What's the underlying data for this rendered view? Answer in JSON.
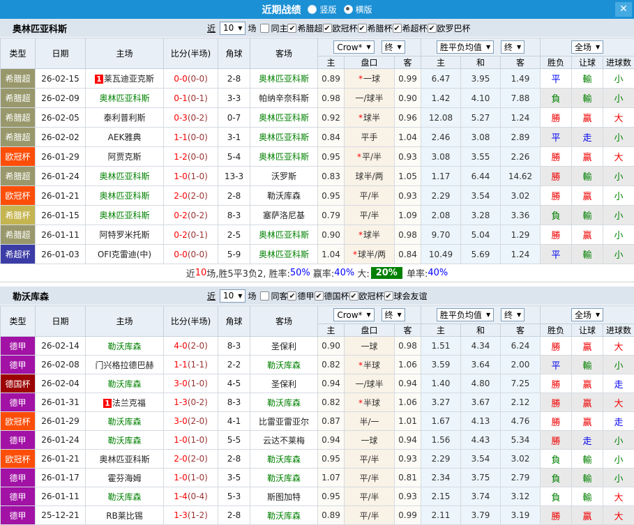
{
  "titlebar": {
    "title": "近期战绩",
    "vertical": "竖版",
    "horizontal": "横版",
    "close": "✕"
  },
  "colors": {
    "titlebar_bg": "#1b90d5",
    "league": {
      "希腊超": "#98986c",
      "欧冠杯": "#fc4e09",
      "希腊杯": "#c5b550",
      "希超杯": "#3c3ca6",
      "德甲": "#a112a5",
      "德国杯": "#9c0303"
    },
    "verdict": {
      "勝": "#f00000",
      "贏": "#f00000",
      "大": "#f00000",
      "平": "#0000f0",
      "走": "#0000f0",
      "負": "#008000",
      "輸": "#008000",
      "小": "#008000"
    }
  },
  "header": {
    "near": "近",
    "games_unit": "场",
    "cols": {
      "type": "类型",
      "date": "日期",
      "home": "主场",
      "score": "比分(半场)",
      "corner": "角球",
      "away": "客场",
      "h": "主",
      "handicap": "盘口",
      "a": "客",
      "w": "主",
      "d": "和",
      "l": "客",
      "result": "胜负",
      "let": "让球",
      "goals": "进球数"
    },
    "selects": {
      "company": "Crow*",
      "final": "终",
      "avg": "胜平负均值",
      "final2": "终",
      "scope": "全场"
    }
  },
  "tables": [
    {
      "team": "奥林匹亚科斯",
      "games": "10",
      "same": "同主",
      "leagues": [
        "希腊超",
        "欧冠杯",
        "希腊杯",
        "希超杯",
        "欧罗巴杯"
      ],
      "rows": [
        {
          "league": "希腊超",
          "date": "26-02-15",
          "home": "莱瓦迪亚克斯",
          "home_badge": "1",
          "score": "0-0",
          "half": "(0-0)",
          "corner": "2-8",
          "away": "奥林匹亚科斯",
          "away_green": true,
          "ah_home": "0.89",
          "ah_star": "*",
          "ah_line": "一球",
          "ah_away": "0.99",
          "eu_home": "6.47",
          "eu_draw": "3.95",
          "eu_away": "1.49",
          "res": "平",
          "let": "輸",
          "goal": "小"
        },
        {
          "league": "希腊超",
          "date": "26-02-09",
          "home": "奥林匹亚科斯",
          "home_green": true,
          "score": "0-1",
          "half": "(0-1)",
          "corner": "3-3",
          "away": "帕纳辛奈科斯",
          "ah_home": "0.98",
          "ah_line": "一/球半",
          "ah_away": "0.90",
          "eu_home": "1.42",
          "eu_draw": "4.10",
          "eu_away": "7.88",
          "res": "負",
          "let": "輸",
          "goal": "小"
        },
        {
          "league": "希腊超",
          "date": "26-02-05",
          "home": "泰利普利斯",
          "score": "0-3",
          "half": "(0-2)",
          "corner": "0-7",
          "away": "奥林匹亚科斯",
          "away_green": true,
          "ah_home": "0.92",
          "ah_star": "*",
          "ah_line": "球半",
          "ah_away": "0.96",
          "eu_home": "12.08",
          "eu_draw": "5.27",
          "eu_away": "1.24",
          "res": "勝",
          "let": "贏",
          "goal": "大"
        },
        {
          "league": "希腊超",
          "date": "26-02-02",
          "home": "AEK雅典",
          "score": "1-1",
          "half": "(0-0)",
          "corner": "3-1",
          "away": "奥林匹亚科斯",
          "away_green": true,
          "ah_home": "0.84",
          "ah_line": "平手",
          "ah_away": "1.04",
          "eu_home": "2.46",
          "eu_draw": "3.08",
          "eu_away": "2.89",
          "res": "平",
          "let": "走",
          "goal": "小"
        },
        {
          "league": "欧冠杯",
          "date": "26-01-29",
          "home": "阿贾克斯",
          "score": "1-2",
          "half": "(0-0)",
          "corner": "5-4",
          "away": "奥林匹亚科斯",
          "away_green": true,
          "ah_home": "0.95",
          "ah_star": "*",
          "ah_line": "平/半",
          "ah_away": "0.93",
          "eu_home": "3.08",
          "eu_draw": "3.55",
          "eu_away": "2.26",
          "res": "勝",
          "let": "贏",
          "goal": "大"
        },
        {
          "league": "希腊超",
          "date": "26-01-24",
          "home": "奥林匹亚科斯",
          "home_green": true,
          "score": "1-0",
          "half": "(1-0)",
          "corner": "13-3",
          "away": "沃罗斯",
          "ah_home": "0.83",
          "ah_line": "球半/两",
          "ah_away": "1.05",
          "eu_home": "1.17",
          "eu_draw": "6.44",
          "eu_away": "14.62",
          "res": "勝",
          "let": "輸",
          "goal": "小"
        },
        {
          "league": "欧冠杯",
          "date": "26-01-21",
          "home": "奥林匹亚科斯",
          "home_green": true,
          "score": "2-0",
          "half": "(2-0)",
          "corner": "2-8",
          "away": "勒沃库森",
          "ah_home": "0.95",
          "ah_line": "平/半",
          "ah_away": "0.93",
          "eu_home": "2.29",
          "eu_draw": "3.54",
          "eu_away": "3.02",
          "res": "勝",
          "let": "贏",
          "goal": "小"
        },
        {
          "league": "希腊杯",
          "date": "26-01-15",
          "home": "奥林匹亚科斯",
          "home_green": true,
          "score": "0-2",
          "half": "(0-2)",
          "corner": "8-3",
          "away": "塞萨洛尼基",
          "ah_home": "0.79",
          "ah_line": "平/半",
          "ah_away": "1.09",
          "eu_home": "2.08",
          "eu_draw": "3.28",
          "eu_away": "3.36",
          "res": "負",
          "let": "輸",
          "goal": "小"
        },
        {
          "league": "希腊超",
          "date": "26-01-11",
          "home": "阿特罗米托斯",
          "score": "0-2",
          "half": "(0-1)",
          "corner": "2-5",
          "away": "奥林匹亚科斯",
          "away_green": true,
          "ah_home": "0.90",
          "ah_star": "*",
          "ah_line": "球半",
          "ah_away": "0.98",
          "eu_home": "9.70",
          "eu_draw": "5.04",
          "eu_away": "1.29",
          "res": "勝",
          "let": "贏",
          "goal": "小"
        },
        {
          "league": "希超杯",
          "date": "26-01-03",
          "home": "OFI克雷迪(中)",
          "score": "0-0",
          "half": "(0-0)",
          "corner": "5-9",
          "away": "奥林匹亚科斯",
          "away_green": true,
          "ah_home": "1.04",
          "ah_star": "*",
          "ah_line": "球半/两",
          "ah_away": "0.84",
          "eu_home": "10.49",
          "eu_draw": "5.69",
          "eu_away": "1.24",
          "res": "平",
          "let": "輸",
          "goal": "小"
        }
      ],
      "summary": [
        {
          "text": "近",
          "color": "#333333"
        },
        {
          "text": "10",
          "color": "#ff0000"
        },
        {
          "text": "场,胜5平3负2, 胜率:",
          "color": "#333333"
        },
        {
          "text": "50%",
          "color": "#0000ff"
        },
        {
          "text": " 赢率:",
          "color": "#333333"
        },
        {
          "text": "40%",
          "color": "#0000ff"
        },
        {
          "text": " 大:",
          "color": "#333333"
        },
        {
          "text": "20%",
          "color": "#ffffff",
          "bg": "#008000"
        },
        {
          "text": " 单率:",
          "color": "#333333"
        },
        {
          "text": "40%",
          "color": "#0000ff"
        }
      ]
    },
    {
      "team": "勒沃库森",
      "games": "10",
      "same": "同客",
      "leagues": [
        "德甲",
        "德国杯",
        "欧冠杯",
        "球会友谊"
      ],
      "rows": [
        {
          "league": "德甲",
          "date": "26-02-14",
          "home": "勒沃库森",
          "home_green": true,
          "score": "4-0",
          "half": "(2-0)",
          "corner": "8-3",
          "away": "圣保利",
          "ah_home": "0.90",
          "ah_line": "一球",
          "ah_away": "0.98",
          "eu_home": "1.51",
          "eu_draw": "4.34",
          "eu_away": "6.24",
          "res": "勝",
          "let": "贏",
          "goal": "大"
        },
        {
          "league": "德甲",
          "date": "26-02-08",
          "home": "门兴格拉德巴赫",
          "score": "1-1",
          "half": "(1-1)",
          "corner": "2-2",
          "away": "勒沃库森",
          "away_green": true,
          "ah_home": "0.82",
          "ah_star": "*",
          "ah_line": "半球",
          "ah_away": "1.06",
          "eu_home": "3.59",
          "eu_draw": "3.64",
          "eu_away": "2.00",
          "res": "平",
          "let": "輸",
          "goal": "小"
        },
        {
          "league": "德国杯",
          "date": "26-02-04",
          "home": "勒沃库森",
          "home_green": true,
          "score": "3-0",
          "half": "(1-0)",
          "corner": "4-5",
          "away": "圣保利",
          "ah_home": "0.94",
          "ah_line": "一/球半",
          "ah_away": "0.94",
          "eu_home": "1.40",
          "eu_draw": "4.80",
          "eu_away": "7.25",
          "res": "勝",
          "let": "贏",
          "goal": "走"
        },
        {
          "league": "德甲",
          "date": "26-01-31",
          "home": "法兰克福",
          "home_badge": "1",
          "score": "1-3",
          "half": "(0-2)",
          "corner": "8-3",
          "away": "勒沃库森",
          "away_green": true,
          "ah_home": "0.82",
          "ah_star": "*",
          "ah_line": "半球",
          "ah_away": "1.06",
          "eu_home": "3.27",
          "eu_draw": "3.67",
          "eu_away": "2.12",
          "res": "勝",
          "let": "贏",
          "goal": "大"
        },
        {
          "league": "欧冠杯",
          "date": "26-01-29",
          "home": "勒沃库森",
          "home_green": true,
          "score": "3-0",
          "half": "(2-0)",
          "corner": "4-1",
          "away": "比雷亚雷亚尔",
          "ah_home": "0.87",
          "ah_line": "半/一",
          "ah_away": "1.01",
          "eu_home": "1.67",
          "eu_draw": "4.13",
          "eu_away": "4.76",
          "res": "勝",
          "let": "贏",
          "goal": "走"
        },
        {
          "league": "德甲",
          "date": "26-01-24",
          "home": "勒沃库森",
          "home_green": true,
          "score": "1-0",
          "half": "(1-0)",
          "corner": "5-5",
          "away": "云达不莱梅",
          "ah_home": "0.94",
          "ah_line": "一球",
          "ah_away": "0.94",
          "eu_home": "1.56",
          "eu_draw": "4.43",
          "eu_away": "5.34",
          "res": "勝",
          "let": "走",
          "goal": "小"
        },
        {
          "league": "欧冠杯",
          "date": "26-01-21",
          "home": "奥林匹亚科斯",
          "score": "2-0",
          "half": "(2-0)",
          "corner": "2-8",
          "away": "勒沃库森",
          "away_green": true,
          "ah_home": "0.95",
          "ah_line": "平/半",
          "ah_away": "0.93",
          "eu_home": "2.29",
          "eu_draw": "3.54",
          "eu_away": "3.02",
          "res": "負",
          "let": "輸",
          "goal": "小"
        },
        {
          "league": "德甲",
          "date": "26-01-17",
          "home": "霍芬海姆",
          "score": "1-0",
          "half": "(1-0)",
          "corner": "3-5",
          "away": "勒沃库森",
          "away_green": true,
          "ah_home": "1.07",
          "ah_line": "平/半",
          "ah_away": "0.81",
          "eu_home": "2.34",
          "eu_draw": "3.75",
          "eu_away": "2.79",
          "res": "負",
          "let": "輸",
          "goal": "小"
        },
        {
          "league": "德甲",
          "date": "26-01-11",
          "home": "勒沃库森",
          "home_green": true,
          "score": "1-4",
          "half": "(0-4)",
          "corner": "5-3",
          "away": "斯图加特",
          "ah_home": "0.95",
          "ah_line": "平/半",
          "ah_away": "0.93",
          "eu_home": "2.15",
          "eu_draw": "3.74",
          "eu_away": "3.12",
          "res": "負",
          "let": "輸",
          "goal": "大"
        },
        {
          "league": "德甲",
          "date": "25-12-21",
          "home": "RB莱比锡",
          "score": "1-3",
          "half": "(1-2)",
          "corner": "2-8",
          "away": "勒沃库森",
          "away_green": true,
          "ah_home": "0.89",
          "ah_line": "平/半",
          "ah_away": "0.99",
          "eu_home": "2.11",
          "eu_draw": "3.79",
          "eu_away": "3.19",
          "res": "勝",
          "let": "贏",
          "goal": "大"
        }
      ]
    }
  ]
}
